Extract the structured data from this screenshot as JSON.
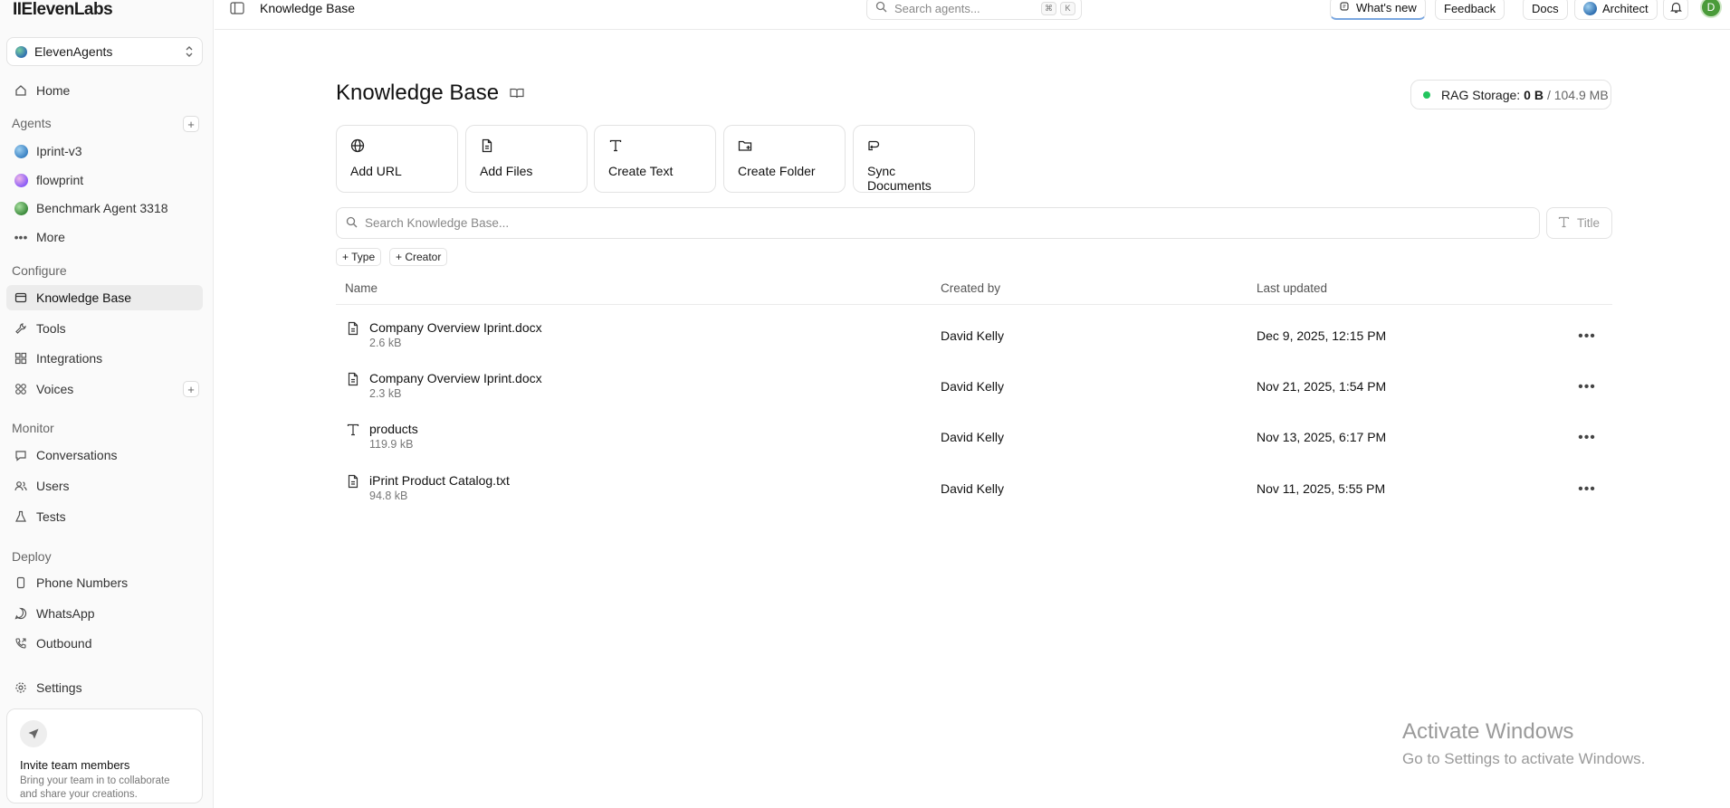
{
  "sidebar": {
    "logo": "IIElevenLabs",
    "workspace": "ElevenAgents",
    "home": "Home",
    "agents_label": "Agents",
    "agents": [
      {
        "name": "Iprint-v3",
        "color": "#3b82c4"
      },
      {
        "name": "flowprint",
        "color": "#8b5cf6"
      },
      {
        "name": "Benchmark Agent 3318",
        "color": "#3c8a3c"
      }
    ],
    "more": "More",
    "configure_label": "Configure",
    "configure": [
      {
        "label": "Knowledge Base",
        "icon": "book-icon",
        "active": true
      },
      {
        "label": "Tools",
        "icon": "wrench-icon",
        "active": false
      },
      {
        "label": "Integrations",
        "icon": "grid-icon",
        "active": false
      },
      {
        "label": "Voices",
        "icon": "voices-icon",
        "active": false
      }
    ],
    "monitor_label": "Monitor",
    "monitor": [
      {
        "label": "Conversations",
        "icon": "chat-icon"
      },
      {
        "label": "Users",
        "icon": "users-icon"
      },
      {
        "label": "Tests",
        "icon": "flask-icon"
      }
    ],
    "deploy_label": "Deploy",
    "deploy": [
      {
        "label": "Phone Numbers",
        "icon": "phone-icon"
      },
      {
        "label": "WhatsApp",
        "icon": "whatsapp-icon"
      },
      {
        "label": "Outbound",
        "icon": "outbound-call-icon"
      }
    ],
    "settings": "Settings",
    "invite": {
      "title": "Invite team members",
      "desc": "Bring your team in to collaborate and share your creations."
    }
  },
  "topbar": {
    "title": "Knowledge Base",
    "search_placeholder": "Search agents...",
    "kbd1": "⌘",
    "kbd2": "K",
    "whats_new": "What's new",
    "feedback": "Feedback",
    "docs": "Docs",
    "architect": "Architect",
    "avatar": "D"
  },
  "main": {
    "title": "Knowledge Base",
    "rag": {
      "label": "RAG Storage:",
      "used": "0 B",
      "total": "/ 104.9 MB"
    },
    "actions": [
      {
        "label": "Add URL",
        "icon": "globe-icon"
      },
      {
        "label": "Add Files",
        "icon": "file-icon"
      },
      {
        "label": "Create Text",
        "icon": "text-icon"
      },
      {
        "label": "Create Folder",
        "icon": "folder-plus-icon"
      },
      {
        "label": "Sync Documents",
        "icon": "sync-icon"
      }
    ],
    "search_placeholder": "Search Knowledge Base...",
    "sort_label": "Title",
    "filters": [
      "+ Type",
      "+ Creator"
    ],
    "columns": {
      "name": "Name",
      "created_by": "Created by",
      "last_updated": "Last updated"
    },
    "rows": [
      {
        "name": "Company Overview Iprint.docx",
        "size": "2.6 kB",
        "creator": "David Kelly",
        "updated": "Dec 9, 2025, 12:15 PM",
        "icon": "file-icon"
      },
      {
        "name": "Company Overview Iprint.docx",
        "size": "2.3 kB",
        "creator": "David Kelly",
        "updated": "Nov 21, 2025, 1:54 PM",
        "icon": "file-icon"
      },
      {
        "name": "products",
        "size": "119.9 kB",
        "creator": "David Kelly",
        "updated": "Nov 13, 2025, 6:17 PM",
        "icon": "text-icon"
      },
      {
        "name": "iPrint Product Catalog.txt",
        "size": "94.8 kB",
        "creator": "David Kelly",
        "updated": "Nov 11, 2025, 5:55 PM",
        "icon": "file-icon"
      }
    ]
  },
  "watermark": {
    "line1": "Activate Windows",
    "line2": "Go to Settings to activate Windows."
  }
}
